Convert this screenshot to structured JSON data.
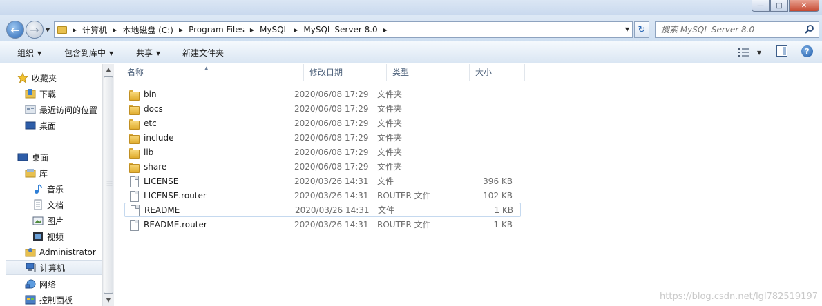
{
  "window": {
    "controls": [
      "min",
      "max",
      "close"
    ]
  },
  "address": {
    "crumbs": [
      "计算机",
      "本地磁盘 (C:)",
      "Program Files",
      "MySQL",
      "MySQL Server 8.0"
    ],
    "search_placeholder": "搜索 MySQL Server 8.0"
  },
  "toolbar": {
    "organize": "组织",
    "include_in_library": "包含到库中",
    "share": "共享",
    "new_folder": "新建文件夹"
  },
  "nav": {
    "items": [
      {
        "label": "收藏夹",
        "icon": "star-icon"
      },
      {
        "label": "下载",
        "icon": "downloads-folder-icon"
      },
      {
        "label": "最近访问的位置",
        "icon": "recent-places-icon"
      },
      {
        "label": "桌面",
        "icon": "desktop-icon"
      },
      {
        "label": "桌面",
        "icon": "desktop-icon"
      },
      {
        "label": "库",
        "icon": "library-icon"
      },
      {
        "label": "音乐",
        "icon": "music-icon"
      },
      {
        "label": "文档",
        "icon": "documents-icon"
      },
      {
        "label": "图片",
        "icon": "pictures-icon"
      },
      {
        "label": "视频",
        "icon": "videos-icon"
      },
      {
        "label": "Administrator",
        "icon": "user-folder-icon"
      },
      {
        "label": "计算机",
        "icon": "computer-icon"
      },
      {
        "label": "网络",
        "icon": "network-icon"
      },
      {
        "label": "控制面板",
        "icon": "control-panel-icon"
      }
    ]
  },
  "columns": {
    "name": "名称",
    "date": "修改日期",
    "type": "类型",
    "size": "大小"
  },
  "files": [
    {
      "name": "bin",
      "date": "2020/06/08 17:29",
      "type": "文件夹",
      "size": "",
      "kind": "folder"
    },
    {
      "name": "docs",
      "date": "2020/06/08 17:29",
      "type": "文件夹",
      "size": "",
      "kind": "folder"
    },
    {
      "name": "etc",
      "date": "2020/06/08 17:29",
      "type": "文件夹",
      "size": "",
      "kind": "folder"
    },
    {
      "name": "include",
      "date": "2020/06/08 17:29",
      "type": "文件夹",
      "size": "",
      "kind": "folder"
    },
    {
      "name": "lib",
      "date": "2020/06/08 17:29",
      "type": "文件夹",
      "size": "",
      "kind": "folder"
    },
    {
      "name": "share",
      "date": "2020/06/08 17:29",
      "type": "文件夹",
      "size": "",
      "kind": "folder"
    },
    {
      "name": "LICENSE",
      "date": "2020/03/26 14:31",
      "type": "文件",
      "size": "396 KB",
      "kind": "file"
    },
    {
      "name": "LICENSE.router",
      "date": "2020/03/26 14:31",
      "type": "ROUTER 文件",
      "size": "102 KB",
      "kind": "file"
    },
    {
      "name": "README",
      "date": "2020/03/26 14:31",
      "type": "文件",
      "size": "1 KB",
      "kind": "file"
    },
    {
      "name": "README.router",
      "date": "2020/03/26 14:31",
      "type": "ROUTER 文件",
      "size": "1 KB",
      "kind": "file"
    }
  ],
  "watermark": "https://blog.csdn.net/lgl782519197"
}
